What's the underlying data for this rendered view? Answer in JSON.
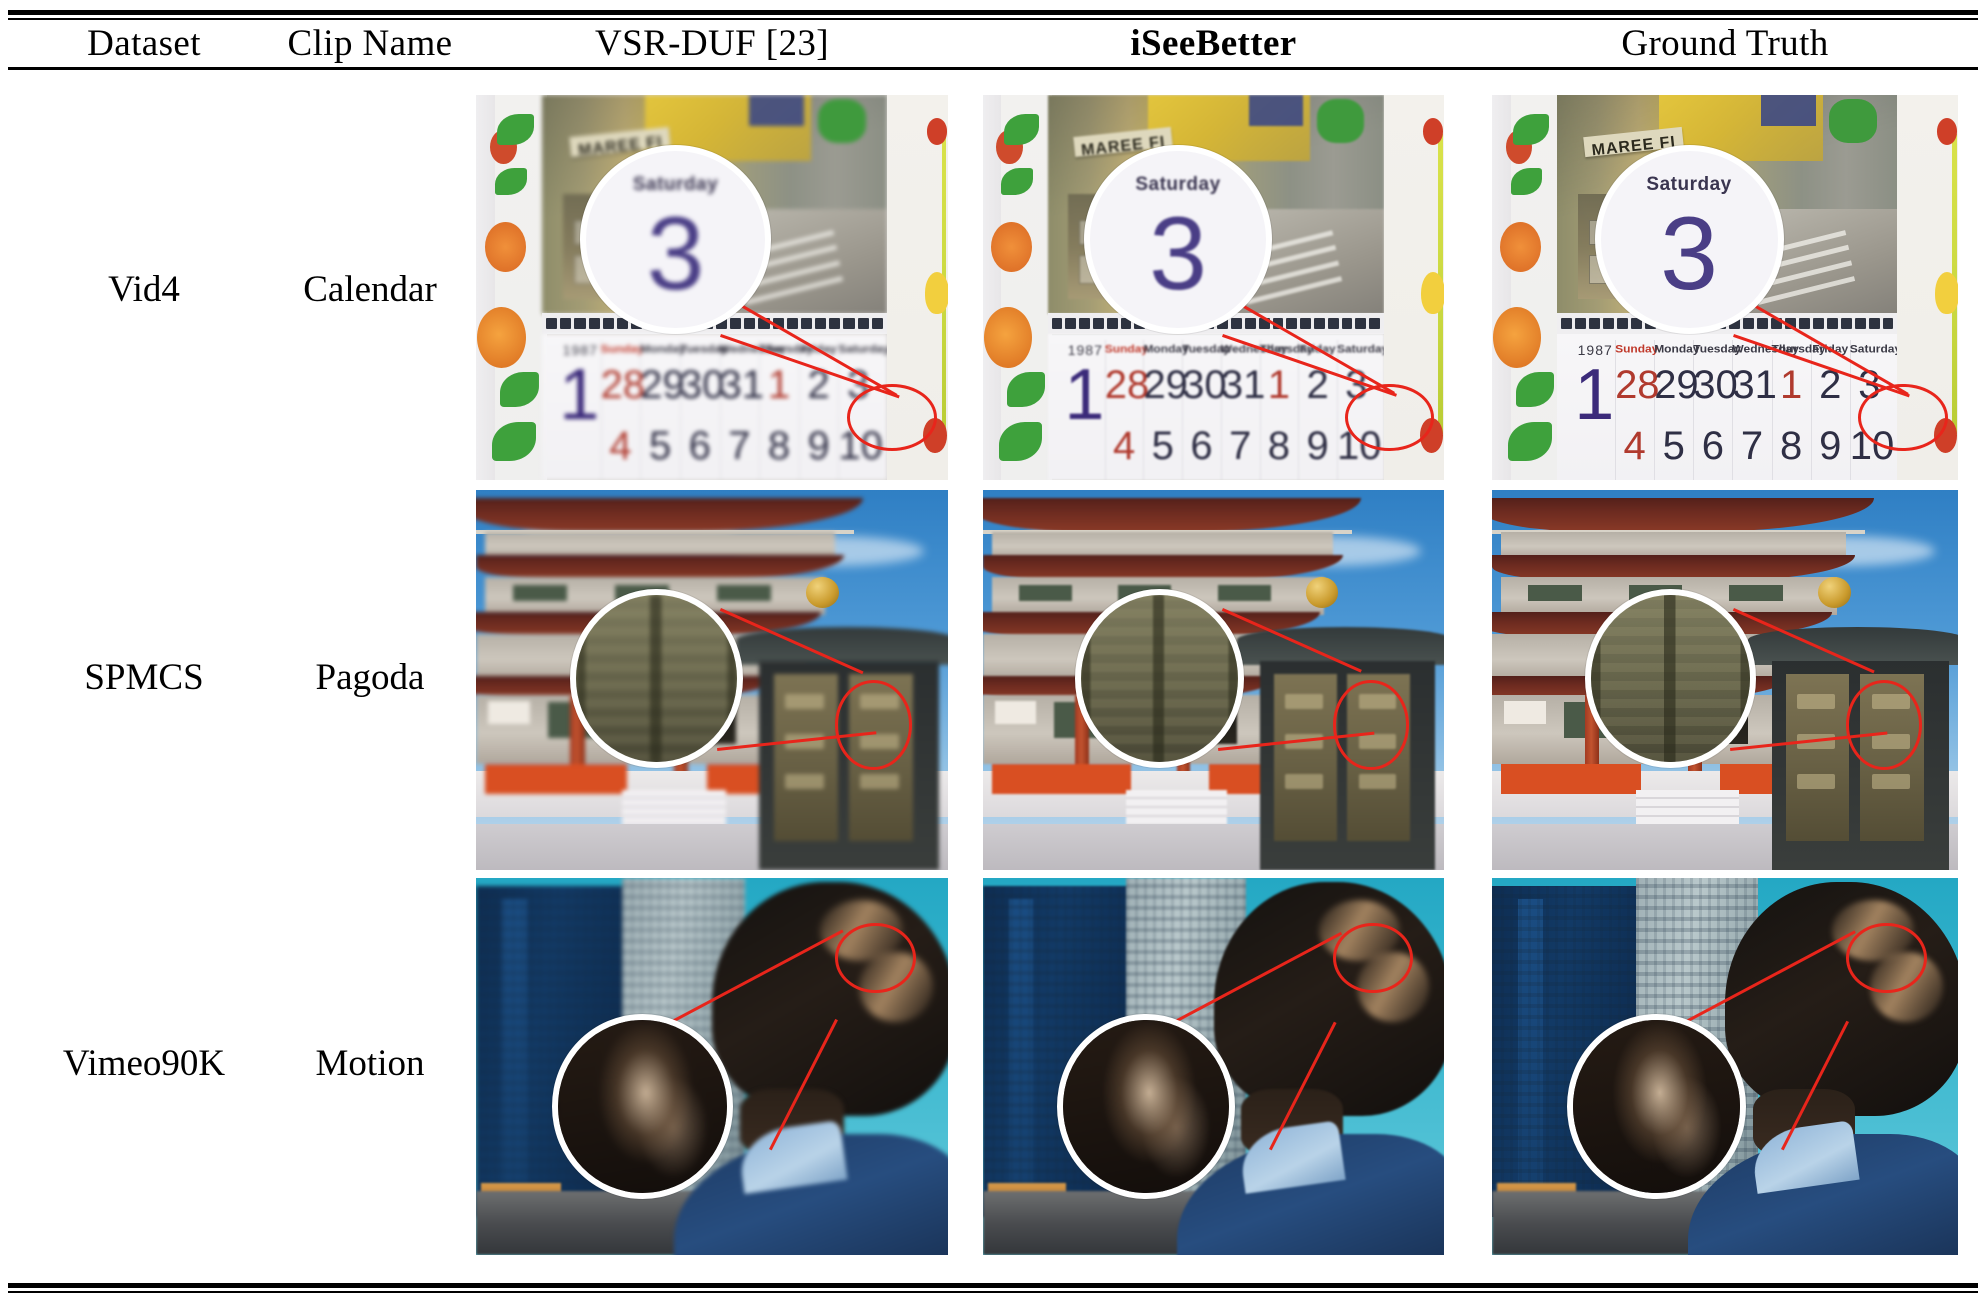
{
  "table": {
    "columns": [
      {
        "key": "dataset",
        "label": "Dataset",
        "bold": false
      },
      {
        "key": "clip",
        "label": "Clip Name",
        "bold": false
      },
      {
        "key": "duf",
        "label": "VSR-DUF [23]",
        "bold": false
      },
      {
        "key": "isb",
        "label": "iSeeBetter",
        "bold": true
      },
      {
        "key": "gt",
        "label": "Ground Truth",
        "bold": false
      }
    ],
    "rows": [
      {
        "dataset": "Vid4",
        "clip": "Calendar",
        "scene": "calendar"
      },
      {
        "dataset": "SPMCS",
        "clip": "Pagoda",
        "scene": "pagoda"
      },
      {
        "dataset": "Vimeo90K",
        "clip": "Motion",
        "scene": "motion"
      }
    ]
  },
  "scenes": {
    "calendar": {
      "poster_sign_text": "MAREE FI",
      "year_label": "1987",
      "big_number": "1",
      "day_names": [
        "Sunday",
        "Monday",
        "Tuesday",
        "Wednesday",
        "Thursday",
        "Friday",
        "Saturday"
      ],
      "week_one": [
        "28",
        "29",
        "30",
        "31",
        "1",
        "2",
        "3"
      ],
      "week_two": [
        "4",
        "5",
        "6",
        "7",
        "8",
        "9",
        "10"
      ],
      "magnifier_label": "Saturday",
      "magnifier_number": "3",
      "highlighted_day": "3",
      "marker_color": "#e8251b"
    },
    "pagoda": {
      "description": "Japanese pagoda temple with ornate metal shrine doors",
      "marker_color": "#e8251b"
    },
    "motion": {
      "description": "Man in blue suit viewed from behind against skyscrapers",
      "marker_color": "#e8251b"
    }
  },
  "detail_quality": {
    "duf": "blurred",
    "isb": "sharper",
    "gt": "sharpest"
  }
}
